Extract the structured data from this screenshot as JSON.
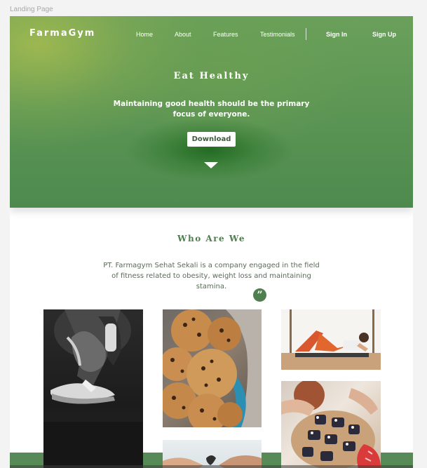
{
  "frame_label": "Landing Page",
  "brand": "FarmaGym",
  "nav": {
    "home": "Home",
    "about": "About",
    "features": "Features",
    "testimonials": "Testimonials",
    "sign_in": "Sign In",
    "sign_up": "Sign Up"
  },
  "hero": {
    "title": "Eat Healthy",
    "subtitle": "Maintaining good health should be the primary focus of everyone.",
    "download_label": "Download"
  },
  "about": {
    "title": "Who Are We",
    "text": "PT. Farmagym Sehat Sekali is a company engaged in the field of fitness related to obesity, weight loss and maintaining stamina.",
    "quote_glyph": "”"
  },
  "colors": {
    "brand_green": "#578a57",
    "accent_green": "#4f7f4f",
    "white": "#ffffff"
  }
}
